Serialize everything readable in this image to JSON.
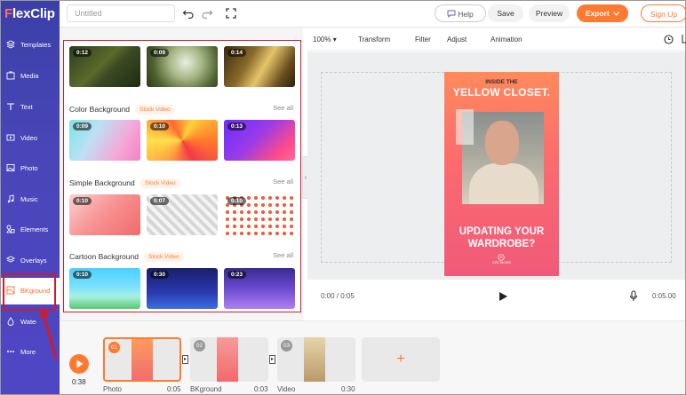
{
  "app": {
    "logo_prefix": "F",
    "logo_rest": "lexClip"
  },
  "sidebar": {
    "items": [
      {
        "label": "Templates",
        "icon": "layers-icon"
      },
      {
        "label": "Media",
        "icon": "media-icon"
      },
      {
        "label": "Text",
        "icon": "text-icon"
      },
      {
        "label": "Video",
        "icon": "video-icon"
      },
      {
        "label": "Photo",
        "icon": "photo-icon"
      },
      {
        "label": "Music",
        "icon": "music-icon"
      },
      {
        "label": "Elements",
        "icon": "elements-icon"
      },
      {
        "label": "Overlays",
        "icon": "overlays-icon"
      },
      {
        "label": "BKground",
        "icon": "background-icon",
        "active": true
      },
      {
        "label": "Watermark",
        "icon": "watermark-icon"
      },
      {
        "label": "More",
        "icon": "more-icon"
      }
    ]
  },
  "topbar": {
    "title_placeholder": "Untitled",
    "help": "Help",
    "save": "Save",
    "preview": "Preview",
    "export": "Export",
    "signup": "Sign Up"
  },
  "panel": {
    "top_row": [
      "0:12",
      "0:09",
      "0:14"
    ],
    "sections": [
      {
        "title": "Color Background",
        "tag": "Stock Video",
        "see_all": "See all",
        "durations": [
          "0:09",
          "0:10",
          "0:13"
        ]
      },
      {
        "title": "Simple Background",
        "tag": "Stock Video",
        "see_all": "See all",
        "durations": [
          "0:10",
          "0:07",
          "0:10"
        ]
      },
      {
        "title": "Cartoon Background",
        "tag": "Stock Video",
        "see_all": "See all",
        "durations": [
          "0:10",
          "0:30",
          "0:23"
        ]
      }
    ]
  },
  "editor": {
    "zoom": "100%",
    "tools": [
      "Transform",
      "Filter",
      "Adjust",
      "Animation"
    ],
    "stage": {
      "line1": "INSIDE THE",
      "line2": "YELLOW CLOSET.",
      "line3": "UPDATING YOUR",
      "line4": "WARDROBE?",
      "line5": "SEE MORE"
    },
    "time_current": "0:00 / 0:05",
    "time_total": "0:05.00"
  },
  "timeline": {
    "total": "0:38",
    "clips": [
      {
        "num": "01",
        "label": "Photo",
        "duration": "0:05"
      },
      {
        "num": "02",
        "label": "BKground",
        "duration": "0:03"
      },
      {
        "num": "03",
        "label": "Video",
        "duration": "0:30"
      }
    ],
    "add": "+"
  },
  "colors": {
    "accent": "#ff7a30",
    "sidebar": "#4a46b9",
    "highlight": "#d01c2a"
  }
}
